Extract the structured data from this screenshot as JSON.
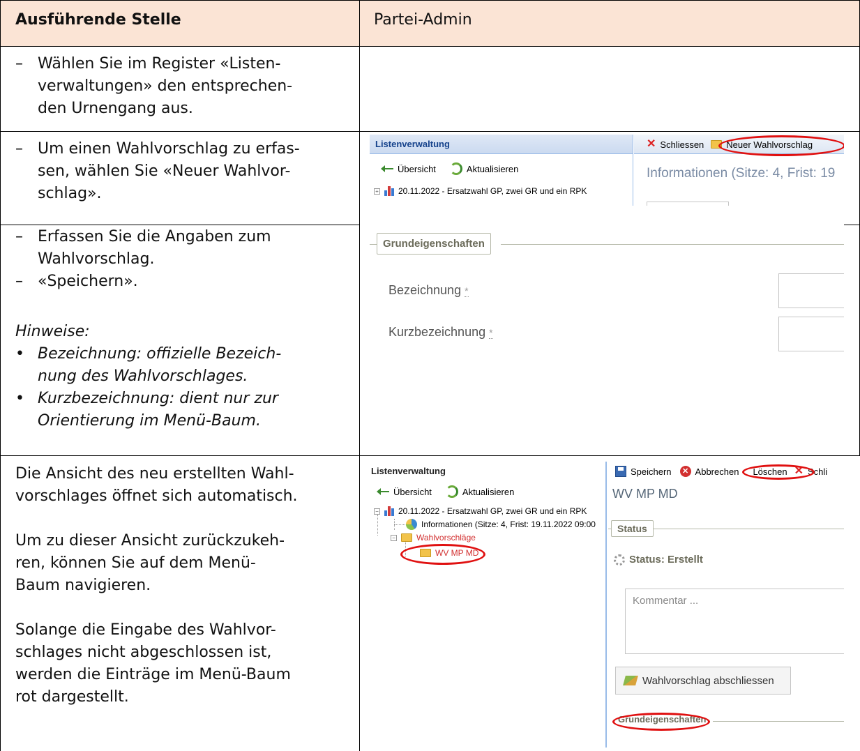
{
  "table": {
    "header_left": "Ausführende Stelle",
    "header_right": "Partei-Admin",
    "row1": {
      "items": [
        "Wählen Sie im Register «Listen-",
        "verwaltungen» den entsprechen-",
        "den Urnengang aus."
      ]
    },
    "row2": {
      "items": [
        "Um einen Wahlvorschlag zu erfas-",
        "sen, wählen Sie «Neuer Wahlvor-",
        "schlag»."
      ]
    },
    "row3": {
      "item1": [
        "Erfassen Sie die Angaben zum",
        "Wahlvorschlag."
      ],
      "item2": "«Speichern».",
      "hint_title": "Hinweise:",
      "bullet1": [
        "Bezeichnung: offizielle Bezeich-",
        "nung des Wahlvorschlages."
      ],
      "bullet2": [
        "Kurzbezeichnung: dient nur zur",
        "Orientierung im Menü-Baum."
      ]
    },
    "row4": {
      "p1": [
        "Die Ansicht des neu erstellten Wahl-",
        "vorschlages öffnet sich automatisch."
      ],
      "p2": [
        "Um zu dieser Ansicht zurückzukeh-",
        "ren, können Sie auf dem Menü-",
        "Baum navigieren."
      ],
      "p3": [
        "Solange die Eingabe des Wahlvor-",
        "schlages nicht abgeschlossen ist,",
        "werden die Einträge im Menü-Baum",
        "rot dargestellt."
      ]
    }
  },
  "screenshot1": {
    "panel_title": "Listenverwaltung",
    "overview": "Übersicht",
    "refresh": "Aktualisieren",
    "tree_item": "20.11.2022 - Ersatzwahl GP, zwei GR und ein RPK",
    "close": "Schliessen",
    "new_proposal": "Neuer Wahlvorschlag",
    "info_title": "Informationen (Sitze: 4, Frist: 19"
  },
  "screenshot2": {
    "legend": "Grundeigenschaften",
    "label_name": "Bezeichnung",
    "label_short": "Kurzbezeichnung",
    "required_mark": "*"
  },
  "screenshot3": {
    "panel_title": "Listenverwaltung",
    "overview": "Übersicht",
    "refresh": "Aktualisieren",
    "tree_root": "20.11.2022 - Ersatzwahl GP, zwei GR und ein RPK",
    "tree_info": "Informationen (Sitze: 4, Frist: 19.11.2022 09:00",
    "tree_folder": "Wahlvorschläge",
    "tree_item": "WV MP MD",
    "save": "Speichern",
    "cancel": "Abbrechen",
    "delete": "Löschen",
    "close_trunc": "Schli",
    "title": "WV MP MD",
    "status_legend": "Status",
    "status_text": "Status: Erstellt",
    "comment_placeholder": "Kommentar ...",
    "finish_button": "Wahlvorschlag abschliessen",
    "bottom_legend": "Grundeigenschaften"
  },
  "colors": {
    "header_bg": "#fbe4d5",
    "annotation": "#e01010",
    "tree_unfinished": "#d23030"
  }
}
